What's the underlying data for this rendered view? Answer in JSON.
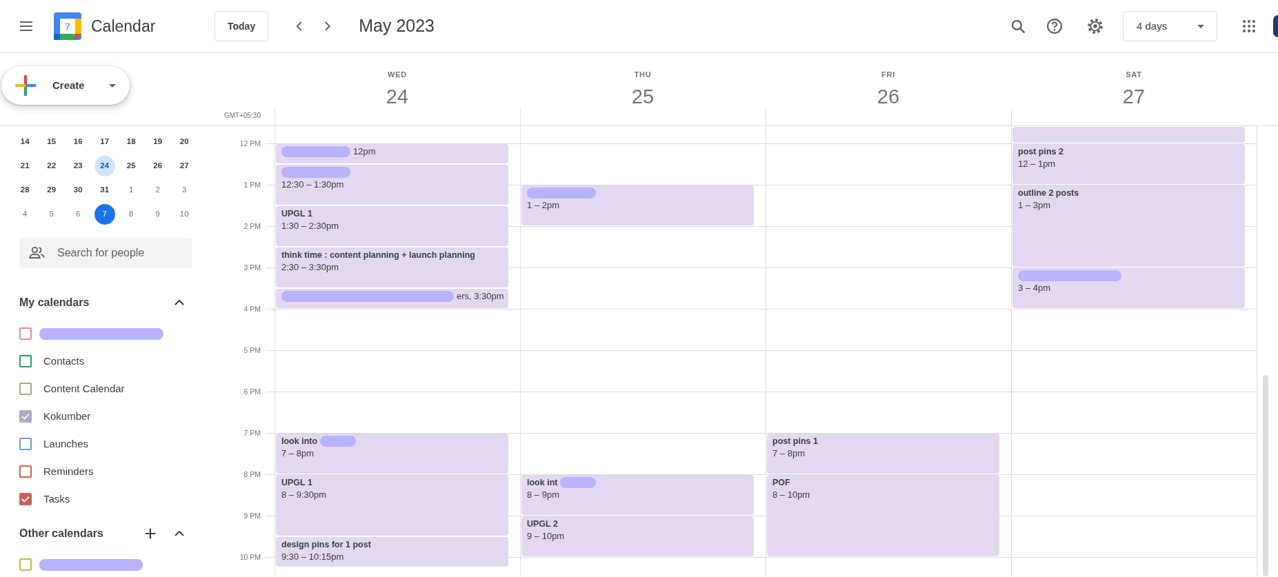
{
  "header": {
    "app_name": "Calendar",
    "logo_day": "7",
    "today_button": "Today",
    "period_title": "May 2023",
    "view_selector": "4 days"
  },
  "sidebar": {
    "create_button": "Create",
    "mini_calendar": {
      "weeks": [
        [
          {
            "day": "14",
            "outside": false,
            "selected": false,
            "today": false
          },
          {
            "day": "15",
            "outside": false,
            "selected": false,
            "today": false
          },
          {
            "day": "16",
            "outside": false,
            "selected": false,
            "today": false
          },
          {
            "day": "17",
            "outside": false,
            "selected": false,
            "today": false
          },
          {
            "day": "18",
            "outside": false,
            "selected": false,
            "today": false
          },
          {
            "day": "19",
            "outside": false,
            "selected": false,
            "today": false
          },
          {
            "day": "20",
            "outside": false,
            "selected": false,
            "today": false
          }
        ],
        [
          {
            "day": "21",
            "outside": false,
            "selected": false,
            "today": false
          },
          {
            "day": "22",
            "outside": false,
            "selected": false,
            "today": false
          },
          {
            "day": "23",
            "outside": false,
            "selected": false,
            "today": false
          },
          {
            "day": "24",
            "outside": false,
            "selected": true,
            "today": false
          },
          {
            "day": "25",
            "outside": false,
            "selected": false,
            "today": false
          },
          {
            "day": "26",
            "outside": false,
            "selected": false,
            "today": false
          },
          {
            "day": "27",
            "outside": false,
            "selected": false,
            "today": false
          }
        ],
        [
          {
            "day": "28",
            "outside": false,
            "selected": false,
            "today": false
          },
          {
            "day": "29",
            "outside": false,
            "selected": false,
            "today": false
          },
          {
            "day": "30",
            "outside": false,
            "selected": false,
            "today": false
          },
          {
            "day": "31",
            "outside": false,
            "selected": false,
            "today": false
          },
          {
            "day": "1",
            "outside": true,
            "selected": false,
            "today": false
          },
          {
            "day": "2",
            "outside": true,
            "selected": false,
            "today": false
          },
          {
            "day": "3",
            "outside": true,
            "selected": false,
            "today": false
          }
        ],
        [
          {
            "day": "4",
            "outside": true,
            "selected": false,
            "today": false
          },
          {
            "day": "5",
            "outside": true,
            "selected": false,
            "today": false
          },
          {
            "day": "6",
            "outside": true,
            "selected": false,
            "today": false
          },
          {
            "day": "7",
            "outside": true,
            "selected": false,
            "today": true
          },
          {
            "day": "8",
            "outside": true,
            "selected": false,
            "today": false
          },
          {
            "day": "9",
            "outside": true,
            "selected": false,
            "today": false
          },
          {
            "day": "10",
            "outside": true,
            "selected": false,
            "today": false
          }
        ]
      ]
    },
    "people_search": {
      "placeholder": "Search for people"
    },
    "calendar_groups": [
      {
        "title": "My calendars",
        "expanded": true,
        "can_add": false,
        "items": [
          {
            "kind": "longmark",
            "color": "#d9909a",
            "checked": false
          },
          {
            "kind": "named",
            "label": "Contacts",
            "color": "#16a765",
            "checked": false
          },
          {
            "kind": "named",
            "label": "Content Calendar",
            "color": "#a9ab7e",
            "checked": false
          },
          {
            "kind": "named",
            "label": "Kokumber",
            "color": "#b3a5c8",
            "checked": true
          },
          {
            "kind": "named",
            "label": "Launches",
            "color": "#6e9dc4",
            "checked": false
          },
          {
            "kind": "named",
            "label": "Reminders",
            "color": "#cf5b55",
            "checked": false
          },
          {
            "kind": "named",
            "label": "Tasks",
            "color": "#c9605a",
            "checked": true
          }
        ]
      },
      {
        "title": "Other calendars",
        "expanded": true,
        "can_add": true,
        "items": [
          {
            "kind": "midmark",
            "color": "#d4b43a",
            "checked": false
          }
        ]
      }
    ]
  },
  "grid": {
    "timezone": "GMT+05:30",
    "hours": [
      "12 PM",
      "1 PM",
      "2 PM",
      "3 PM",
      "4 PM",
      "5 PM",
      "6 PM",
      "7 PM",
      "8 PM",
      "9 PM",
      "10 PM"
    ],
    "days": [
      {
        "weekday": "WED",
        "date": "24",
        "events": [
          {
            "kind": "inline",
            "parts": [
              {
                "kind": "shortmark"
              },
              {
                "kind": "text",
                "text": "12pm"
              }
            ]
          },
          {
            "kind": "stacked",
            "title_parts": [
              {
                "kind": "shortmark"
              }
            ],
            "time": "12:30 – 1:30pm"
          },
          {
            "kind": "stacked",
            "title": "UPGL 1",
            "time": "1:30 – 2:30pm"
          },
          {
            "kind": "stacked",
            "title": "think time : content planning + launch planning",
            "time": "2:30 – 3:30pm"
          },
          {
            "kind": "inline",
            "parts": [
              {
                "kind": "widemark"
              },
              {
                "kind": "text",
                "text": "ers, 3:30pm"
              }
            ]
          },
          {
            "kind": "stacked",
            "title_parts": [
              {
                "kind": "text",
                "text": "look into"
              },
              {
                "kind": "tinymark"
              }
            ],
            "time": "7 – 8pm"
          },
          {
            "kind": "stacked",
            "title": "UPGL 1",
            "time": "8 – 9:30pm"
          },
          {
            "kind": "stacked",
            "title": "design pins for 1 post",
            "time": "9:30 – 10:15pm"
          }
        ]
      },
      {
        "weekday": "THU",
        "date": "25",
        "events": [
          {
            "kind": "stacked",
            "title_parts": [
              {
                "kind": "shortmark"
              }
            ],
            "time": "1 – 2pm"
          },
          {
            "kind": "stacked",
            "title_parts": [
              {
                "kind": "text",
                "text": "look int"
              },
              {
                "kind": "tinymark"
              }
            ],
            "time": "8 – 9pm"
          },
          {
            "kind": "stacked",
            "title": "UPGL 2",
            "time": "9 – 10pm"
          }
        ]
      },
      {
        "weekday": "FRI",
        "date": "26",
        "events": [
          {
            "kind": "stacked",
            "title": "post pins 1",
            "time": "7 – 8pm"
          },
          {
            "kind": "stacked",
            "title": "POF",
            "time": "8 – 10pm"
          }
        ]
      },
      {
        "weekday": "SAT",
        "date": "27",
        "events": [
          {
            "kind": "clipped"
          },
          {
            "kind": "stacked",
            "title": "post pins 2",
            "time": "12 – 1pm"
          },
          {
            "kind": "stacked",
            "title": "outline 2 posts",
            "time": "1 – 3pm"
          },
          {
            "kind": "stacked",
            "title_parts": [
              {
                "kind": "midmark"
              }
            ],
            "time": "3 – 4pm"
          }
        ]
      }
    ]
  }
}
